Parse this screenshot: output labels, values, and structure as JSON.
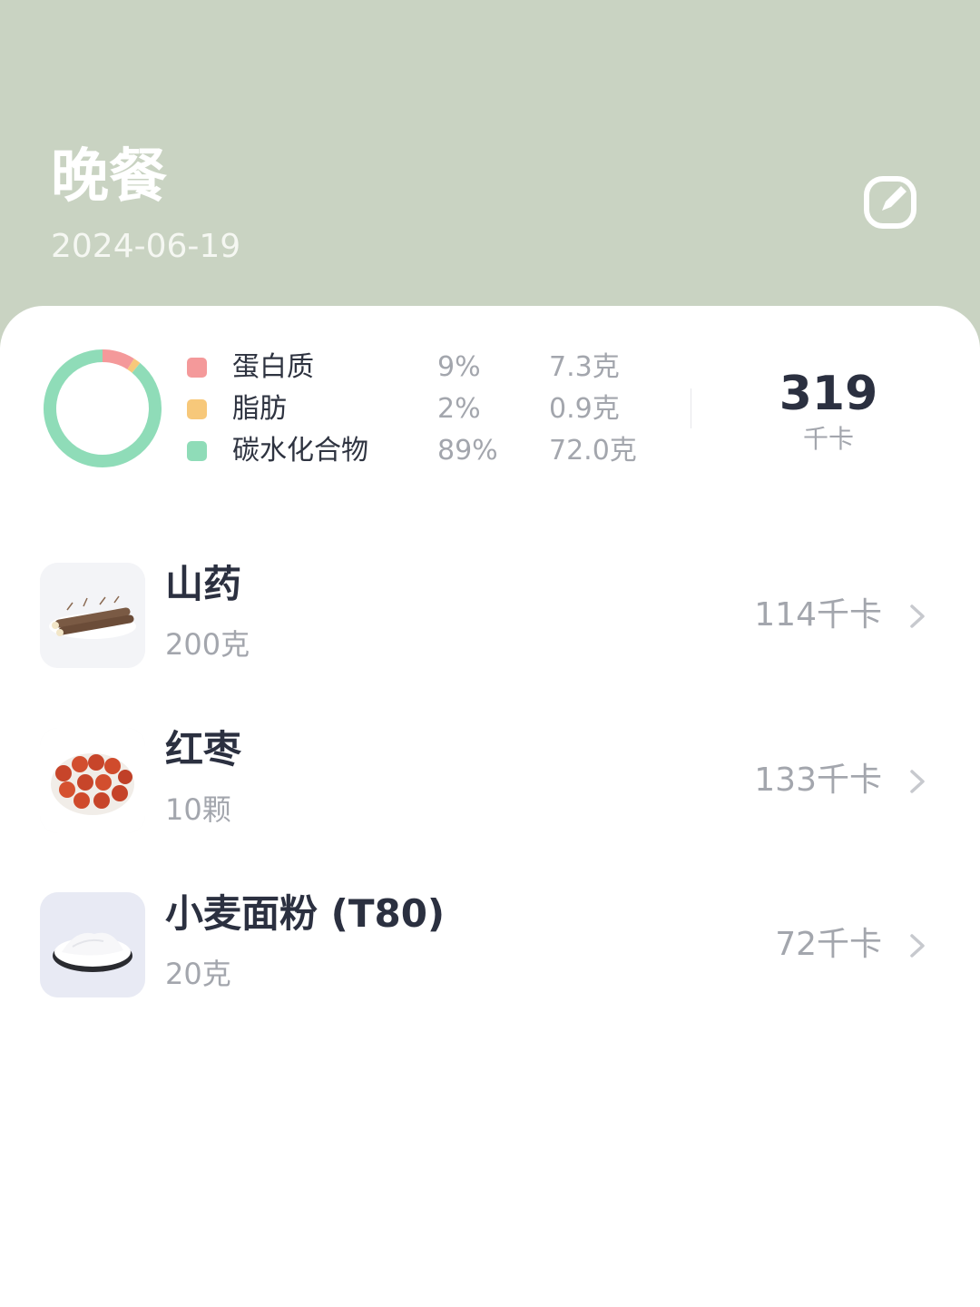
{
  "header": {
    "title": "晚餐",
    "date": "2024-06-19",
    "edit_icon": "edit-icon",
    "background_color": "#c9d3c2"
  },
  "summary": {
    "macros": [
      {
        "name": "蛋白质",
        "percent": "9%",
        "grams": "7.3克",
        "color": "#f4999a"
      },
      {
        "name": "脂肪",
        "percent": "2%",
        "grams": "0.9克",
        "color": "#f7c87a"
      },
      {
        "name": "碳水化合物",
        "percent": "89%",
        "grams": "72.0克",
        "color": "#8fdcb8"
      }
    ],
    "calories": "319",
    "calories_unit": "千卡"
  },
  "chart_data": {
    "type": "pie",
    "categories": [
      "蛋白质",
      "脂肪",
      "碳水化合物"
    ],
    "values": [
      9,
      2,
      89
    ],
    "colors": [
      "#f4999a",
      "#f7c87a",
      "#8fdcb8"
    ]
  },
  "foods": [
    {
      "name": "山药",
      "amount": "200克",
      "kcal": "114千卡",
      "image": "yam-thumbnail"
    },
    {
      "name": "红枣",
      "amount": "10颗",
      "kcal": "133千卡",
      "image": "red-dates-thumbnail"
    },
    {
      "name": "小麦面粉 (T80)",
      "amount": "20克",
      "kcal": "72千卡",
      "image": "wheat-flour-thumbnail"
    }
  ]
}
